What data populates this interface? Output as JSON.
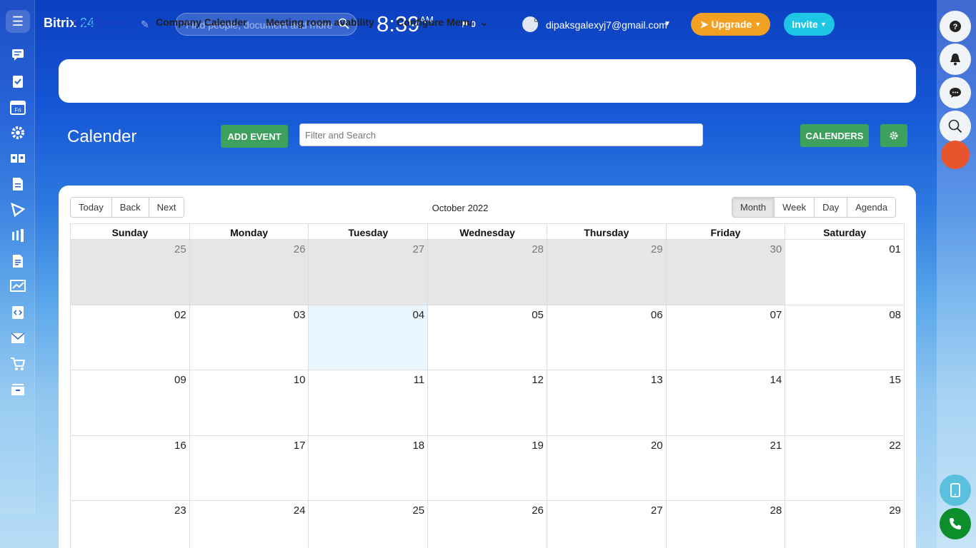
{
  "brand": {
    "name": "Bitrix",
    "num": "24"
  },
  "topbar": {
    "search_placeholder": "Find people, document and more",
    "time": "8:39",
    "ampm": "AM",
    "flag_count": "0",
    "user_email": "dipaksgalexyj7@gmail.com",
    "upgrade_label": "Upgrade",
    "invite_label": "Invite",
    "accent_orange": "#f2a022",
    "accent_cyan": "#1ec6e6"
  },
  "left_sidebar": {
    "calendar_icon_text": "Fri"
  },
  "tabs": {
    "my_calendar": "My Calender",
    "company_calendar": "Company Calender",
    "meeting_room": "Meeting room avability",
    "configure_menu": "Configure Menu"
  },
  "calendar_header": {
    "title": "Calender",
    "add_event": "ADD EVENT",
    "filter_placeholder": "Filter and Search",
    "calendars": "CALENDERS",
    "button_color": "#3da05c"
  },
  "toolbar": {
    "today": "Today",
    "back": "Back",
    "next": "Next",
    "label": "October 2022",
    "views": {
      "month": "Month",
      "week": "Week",
      "day": "Day",
      "agenda": "Agenda"
    },
    "active_view": "Month"
  },
  "weekdays": [
    "Sunday",
    "Monday",
    "Tuesday",
    "Wednesday",
    "Thursday",
    "Friday",
    "Saturday"
  ],
  "weeks": [
    [
      "25",
      "26",
      "27",
      "28",
      "29",
      "30",
      "01"
    ],
    [
      "02",
      "03",
      "04",
      "05",
      "06",
      "07",
      "08"
    ],
    [
      "09",
      "10",
      "11",
      "12",
      "13",
      "14",
      "15"
    ],
    [
      "16",
      "17",
      "18",
      "19",
      "20",
      "21",
      "22"
    ],
    [
      "23",
      "24",
      "25",
      "26",
      "27",
      "28",
      "29"
    ]
  ]
}
